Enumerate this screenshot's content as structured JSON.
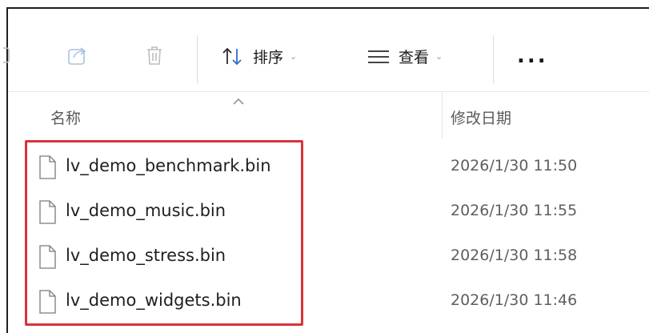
{
  "toolbar": {
    "share_icon": "share-icon",
    "delete_icon": "trash-icon",
    "sort": {
      "label": "排序",
      "icon": "sort-arrows-icon"
    },
    "view": {
      "label": "查看",
      "icon": "view-lines-icon"
    },
    "more_label": "..."
  },
  "columns": {
    "name": "名称",
    "date": "修改日期"
  },
  "files": [
    {
      "name": "lv_demo_benchmark.bin",
      "date": "2026/1/30 11:50"
    },
    {
      "name": "lv_demo_music.bin",
      "date": "2026/1/30 11:55"
    },
    {
      "name": "lv_demo_stress.bin",
      "date": "2026/1/30 11:58"
    },
    {
      "name": "lv_demo_widgets.bin",
      "date": "2026/1/30 11:46"
    }
  ],
  "colors": {
    "highlight": "#d8333a",
    "frame": "#1f1f1f"
  }
}
